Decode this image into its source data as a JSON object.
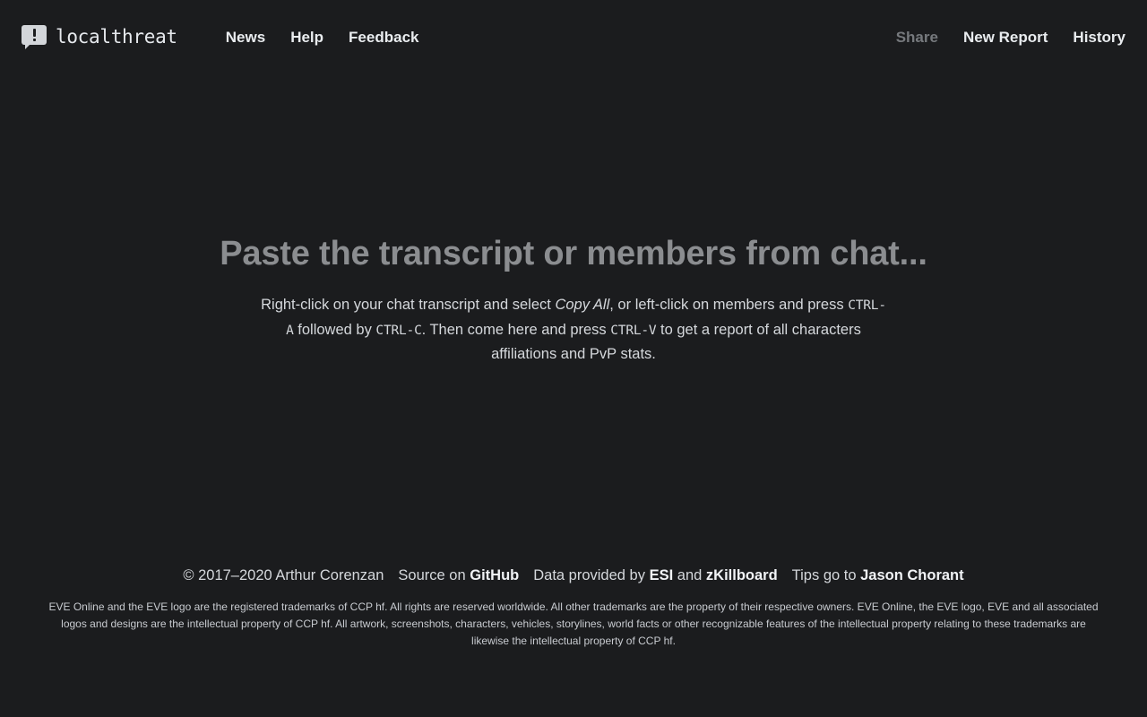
{
  "brand": {
    "name": "localthreat",
    "logo_icon": "speech-bubble-alert-icon"
  },
  "nav": {
    "left": [
      {
        "label": "News",
        "name": "nav-link-news",
        "muted": false
      },
      {
        "label": "Help",
        "name": "nav-link-help",
        "muted": false
      },
      {
        "label": "Feedback",
        "name": "nav-link-feedback",
        "muted": false
      }
    ],
    "right": [
      {
        "label": "Share",
        "name": "nav-link-share",
        "muted": true
      },
      {
        "label": "New Report",
        "name": "nav-link-new-report",
        "muted": false
      },
      {
        "label": "History",
        "name": "nav-link-history",
        "muted": false
      }
    ]
  },
  "main": {
    "empty_title": "Paste the transcript or members from chat...",
    "desc": {
      "part1": "Right-click on your chat transcript and select ",
      "emphasis": "Copy All",
      "part2": ", or left-click on members and press ",
      "key1": "CTRL-A",
      "part3": " followed by ",
      "key2": "CTRL-C",
      "part4": ". Then come here and press ",
      "key3": "CTRL-V",
      "part5": " to get a report of all characters affiliations and PvP stats."
    }
  },
  "footer": {
    "copyright": "© 2017–2020 Arthur Corenzan",
    "source_prefix": "Source on",
    "source_link": "GitHub",
    "data_prefix": "Data provided by",
    "data_link_1": "ESI",
    "data_conjunction": "and",
    "data_link_2": "zKillboard",
    "tips_prefix": "Tips go to",
    "tips_link": "Jason Chorant",
    "disclaimer": "EVE Online and the EVE logo are the registered trademarks of CCP hf. All rights are reserved worldwide. All other trademarks are the property of their respective owners. EVE Online, the EVE logo, EVE and all associated logos and designs are the intellectual property of CCP hf. All artwork, screenshots, characters, vehicles, storylines, world facts or other recognizable features of the intellectual property relating to these trademarks are likewise the intellectual property of CCP hf."
  },
  "colors": {
    "background": "#1b1c1e",
    "text": "#d5d8dc",
    "muted": "#76797d",
    "title": "#8b8d90",
    "logo": "#d3d6da"
  }
}
